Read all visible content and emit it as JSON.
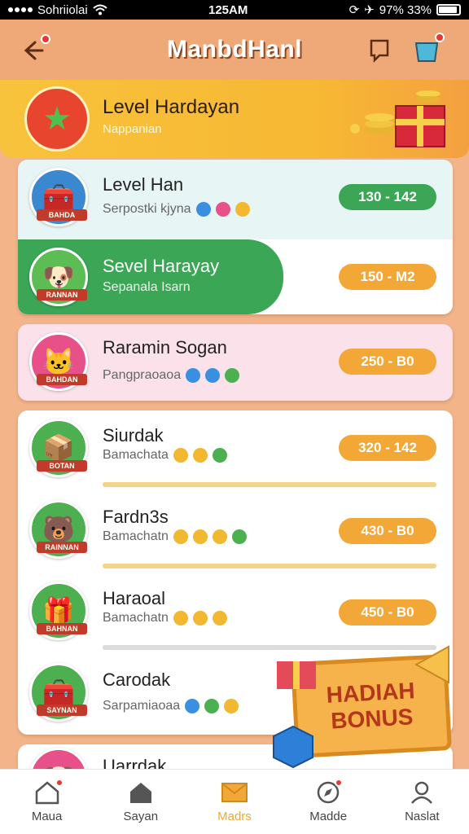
{
  "status_bar": {
    "carrier": "Sohriiolai",
    "time": "125AM",
    "battery": "97% 33%"
  },
  "header": {
    "title": "ManbdHanl"
  },
  "banner": {
    "title": "Level Hardayan",
    "subtitle": "Nappanian"
  },
  "colors": {
    "accent_orange": "#f2a736",
    "accent_green": "#3aa656",
    "background": "#f4b48a",
    "banner_yellow": "#f8c33c"
  },
  "list": [
    {
      "title": "Level Han",
      "subtitle": "Serpostki kjyna",
      "value": "130 - 142",
      "style": "green"
    },
    {
      "title": "Sevel Harayay",
      "subtitle": "Sepanala Isarn",
      "value": "150 - M2",
      "style": "orange"
    },
    {
      "title": "Raramin Sogan",
      "subtitle": "Pangpraoaoa",
      "value": "250 - B0",
      "style": "orange"
    },
    {
      "title": "Siurdak",
      "subtitle": "Bamachata",
      "value": "320 - 142",
      "style": "orange",
      "progress": 1.0
    },
    {
      "title": "Fardn3s",
      "subtitle": "Bamachatn",
      "value": "430 - B0",
      "style": "orange",
      "progress": 1.0
    },
    {
      "title": "Haraoal",
      "subtitle": "Bamachatn",
      "value": "450 - B0",
      "style": "orange",
      "progress": 1.0
    },
    {
      "title": "Carodak",
      "subtitle": "Sarpamiaoaa",
      "value": "",
      "style": "orange"
    },
    {
      "title": "Uarrdak",
      "subtitle": "",
      "value": "",
      "style": "orange"
    }
  ],
  "avatar_tags": [
    "BAHDA",
    "RANNAN",
    "BAHDAN",
    "BOTAN",
    "RAINNAN",
    "BAHNAN",
    "SAYNAN",
    ""
  ],
  "bonus": {
    "line1": "HADIAH",
    "line2": "BONUS"
  },
  "bottom_nav": [
    {
      "label": "Maua",
      "icon": "home-icon"
    },
    {
      "label": "Sayan",
      "icon": "house-icon"
    },
    {
      "label": "Madrs",
      "icon": "envelope-icon",
      "active": true
    },
    {
      "label": "Madde",
      "icon": "compass-icon"
    },
    {
      "label": "Naslat",
      "icon": "user-icon"
    }
  ]
}
